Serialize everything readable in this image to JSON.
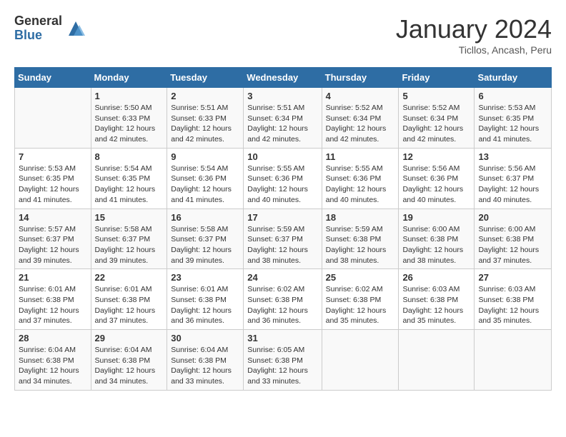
{
  "header": {
    "logo_general": "General",
    "logo_blue": "Blue",
    "title": "January 2024",
    "subtitle": "Ticllos, Ancash, Peru"
  },
  "days_of_week": [
    "Sunday",
    "Monday",
    "Tuesday",
    "Wednesday",
    "Thursday",
    "Friday",
    "Saturday"
  ],
  "weeks": [
    [
      {
        "day": "",
        "info": ""
      },
      {
        "day": "1",
        "info": "Sunrise: 5:50 AM\nSunset: 6:33 PM\nDaylight: 12 hours and 42 minutes."
      },
      {
        "day": "2",
        "info": "Sunrise: 5:51 AM\nSunset: 6:33 PM\nDaylight: 12 hours and 42 minutes."
      },
      {
        "day": "3",
        "info": "Sunrise: 5:51 AM\nSunset: 6:34 PM\nDaylight: 12 hours and 42 minutes."
      },
      {
        "day": "4",
        "info": "Sunrise: 5:52 AM\nSunset: 6:34 PM\nDaylight: 12 hours and 42 minutes."
      },
      {
        "day": "5",
        "info": "Sunrise: 5:52 AM\nSunset: 6:34 PM\nDaylight: 12 hours and 42 minutes."
      },
      {
        "day": "6",
        "info": "Sunrise: 5:53 AM\nSunset: 6:35 PM\nDaylight: 12 hours and 41 minutes."
      }
    ],
    [
      {
        "day": "7",
        "info": "Sunrise: 5:53 AM\nSunset: 6:35 PM\nDaylight: 12 hours and 41 minutes."
      },
      {
        "day": "8",
        "info": "Sunrise: 5:54 AM\nSunset: 6:35 PM\nDaylight: 12 hours and 41 minutes."
      },
      {
        "day": "9",
        "info": "Sunrise: 5:54 AM\nSunset: 6:36 PM\nDaylight: 12 hours and 41 minutes."
      },
      {
        "day": "10",
        "info": "Sunrise: 5:55 AM\nSunset: 6:36 PM\nDaylight: 12 hours and 40 minutes."
      },
      {
        "day": "11",
        "info": "Sunrise: 5:55 AM\nSunset: 6:36 PM\nDaylight: 12 hours and 40 minutes."
      },
      {
        "day": "12",
        "info": "Sunrise: 5:56 AM\nSunset: 6:36 PM\nDaylight: 12 hours and 40 minutes."
      },
      {
        "day": "13",
        "info": "Sunrise: 5:56 AM\nSunset: 6:37 PM\nDaylight: 12 hours and 40 minutes."
      }
    ],
    [
      {
        "day": "14",
        "info": "Sunrise: 5:57 AM\nSunset: 6:37 PM\nDaylight: 12 hours and 39 minutes."
      },
      {
        "day": "15",
        "info": "Sunrise: 5:58 AM\nSunset: 6:37 PM\nDaylight: 12 hours and 39 minutes."
      },
      {
        "day": "16",
        "info": "Sunrise: 5:58 AM\nSunset: 6:37 PM\nDaylight: 12 hours and 39 minutes."
      },
      {
        "day": "17",
        "info": "Sunrise: 5:59 AM\nSunset: 6:37 PM\nDaylight: 12 hours and 38 minutes."
      },
      {
        "day": "18",
        "info": "Sunrise: 5:59 AM\nSunset: 6:38 PM\nDaylight: 12 hours and 38 minutes."
      },
      {
        "day": "19",
        "info": "Sunrise: 6:00 AM\nSunset: 6:38 PM\nDaylight: 12 hours and 38 minutes."
      },
      {
        "day": "20",
        "info": "Sunrise: 6:00 AM\nSunset: 6:38 PM\nDaylight: 12 hours and 37 minutes."
      }
    ],
    [
      {
        "day": "21",
        "info": "Sunrise: 6:01 AM\nSunset: 6:38 PM\nDaylight: 12 hours and 37 minutes."
      },
      {
        "day": "22",
        "info": "Sunrise: 6:01 AM\nSunset: 6:38 PM\nDaylight: 12 hours and 37 minutes."
      },
      {
        "day": "23",
        "info": "Sunrise: 6:01 AM\nSunset: 6:38 PM\nDaylight: 12 hours and 36 minutes."
      },
      {
        "day": "24",
        "info": "Sunrise: 6:02 AM\nSunset: 6:38 PM\nDaylight: 12 hours and 36 minutes."
      },
      {
        "day": "25",
        "info": "Sunrise: 6:02 AM\nSunset: 6:38 PM\nDaylight: 12 hours and 35 minutes."
      },
      {
        "day": "26",
        "info": "Sunrise: 6:03 AM\nSunset: 6:38 PM\nDaylight: 12 hours and 35 minutes."
      },
      {
        "day": "27",
        "info": "Sunrise: 6:03 AM\nSunset: 6:38 PM\nDaylight: 12 hours and 35 minutes."
      }
    ],
    [
      {
        "day": "28",
        "info": "Sunrise: 6:04 AM\nSunset: 6:38 PM\nDaylight: 12 hours and 34 minutes."
      },
      {
        "day": "29",
        "info": "Sunrise: 6:04 AM\nSunset: 6:38 PM\nDaylight: 12 hours and 34 minutes."
      },
      {
        "day": "30",
        "info": "Sunrise: 6:04 AM\nSunset: 6:38 PM\nDaylight: 12 hours and 33 minutes."
      },
      {
        "day": "31",
        "info": "Sunrise: 6:05 AM\nSunset: 6:38 PM\nDaylight: 12 hours and 33 minutes."
      },
      {
        "day": "",
        "info": ""
      },
      {
        "day": "",
        "info": ""
      },
      {
        "day": "",
        "info": ""
      }
    ]
  ]
}
